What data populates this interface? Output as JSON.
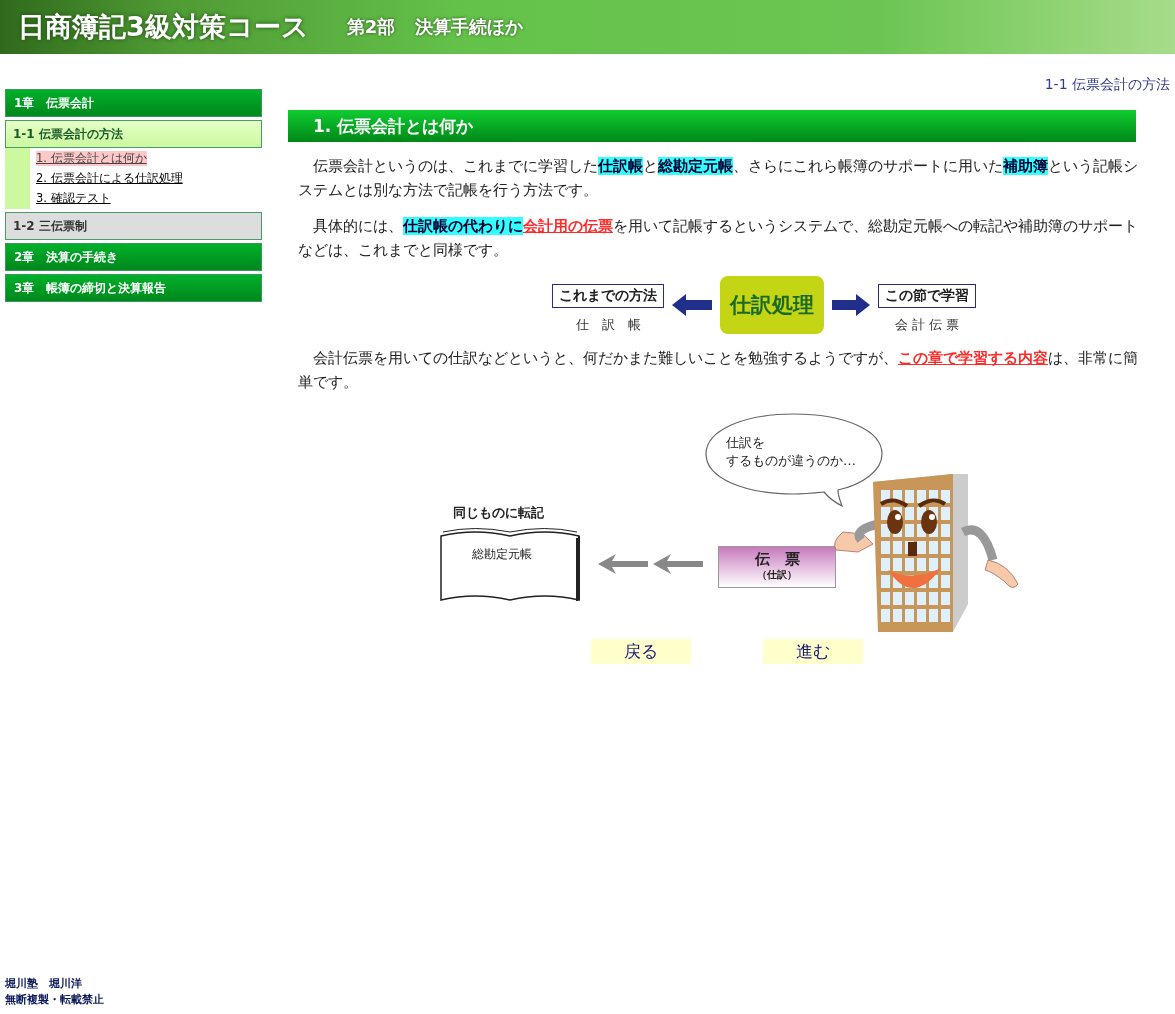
{
  "header": {
    "title": "日商簿記3級対策コース",
    "part": "第2部",
    "subtitle": "決算手続ほか"
  },
  "sidebar": [
    {
      "kind": "chapter",
      "label": "1章　伝票会計"
    },
    {
      "kind": "section",
      "label": "1-1 伝票会計の方法",
      "selected": true,
      "children": [
        {
          "label": "1. 伝票会計とは何か",
          "selected": true
        },
        {
          "label": "2. 伝票会計による仕訳処理",
          "selected": false
        },
        {
          "label": "3. 確認テスト",
          "selected": false
        }
      ]
    },
    {
      "kind": "section",
      "label": "1-2 三伝票制",
      "selected": false
    },
    {
      "kind": "chapter",
      "label": "2章　決算の手続き"
    },
    {
      "kind": "chapter",
      "label": "3章　帳簿の締切と決算報告"
    }
  ],
  "breadcrumb": "1-1 伝票会計の方法",
  "heading": "1. 伝票会計とは何か",
  "paragraphs": [
    [
      {
        "kind": "plain",
        "text": "伝票会計というのは、これまでに学習した"
      },
      {
        "kind": "highlight",
        "text": "仕訳帳"
      },
      {
        "kind": "plain",
        "text": "と"
      },
      {
        "kind": "highlight",
        "text": "総勘定元帳"
      },
      {
        "kind": "plain",
        "text": "、さらにこれら帳簿のサポートに用いた"
      },
      {
        "kind": "highlight",
        "text": "補助簿"
      },
      {
        "kind": "plain",
        "text": "という記帳システムとは別な方法で記帳を行う方法です。"
      }
    ],
    [
      {
        "kind": "plain",
        "text": "具体的には、"
      },
      {
        "kind": "highlight",
        "text": "仕訳帳の代わりに"
      },
      {
        "kind": "emphasis",
        "text": "会計用の伝票"
      },
      {
        "kind": "plain",
        "text": "を用いて記帳するというシステムで、総勘定元帳への転記や補助簿のサポートなどは、これまでと同様です。"
      }
    ]
  ],
  "diagram": {
    "left": {
      "label": "これまでの方法",
      "caption": "仕　訳　帳"
    },
    "center": "仕訳処理",
    "right": {
      "label": "この節で学習",
      "caption": "会 計 伝 票"
    }
  },
  "paragraph_after": [
    {
      "kind": "plain",
      "text": "会計伝票を用いての仕訳などというと、何だかまた難しいことを勉強するようですが、"
    },
    {
      "kind": "emphasis",
      "text": "この章で学習する内容"
    },
    {
      "kind": "plain",
      "text": "は、非常に簡単です。"
    }
  ],
  "illustration": {
    "speech": [
      "仕訳を",
      "するものが違うのか…"
    ],
    "caption": "同じものに転記",
    "book": "総勘定元帳",
    "slip": {
      "title": "伝　票",
      "sub": "（仕訳）"
    }
  },
  "nav": [
    "戻る",
    "進む"
  ],
  "footer": [
    "堀川塾　堀川洋",
    "無断複製・転載禁止"
  ]
}
